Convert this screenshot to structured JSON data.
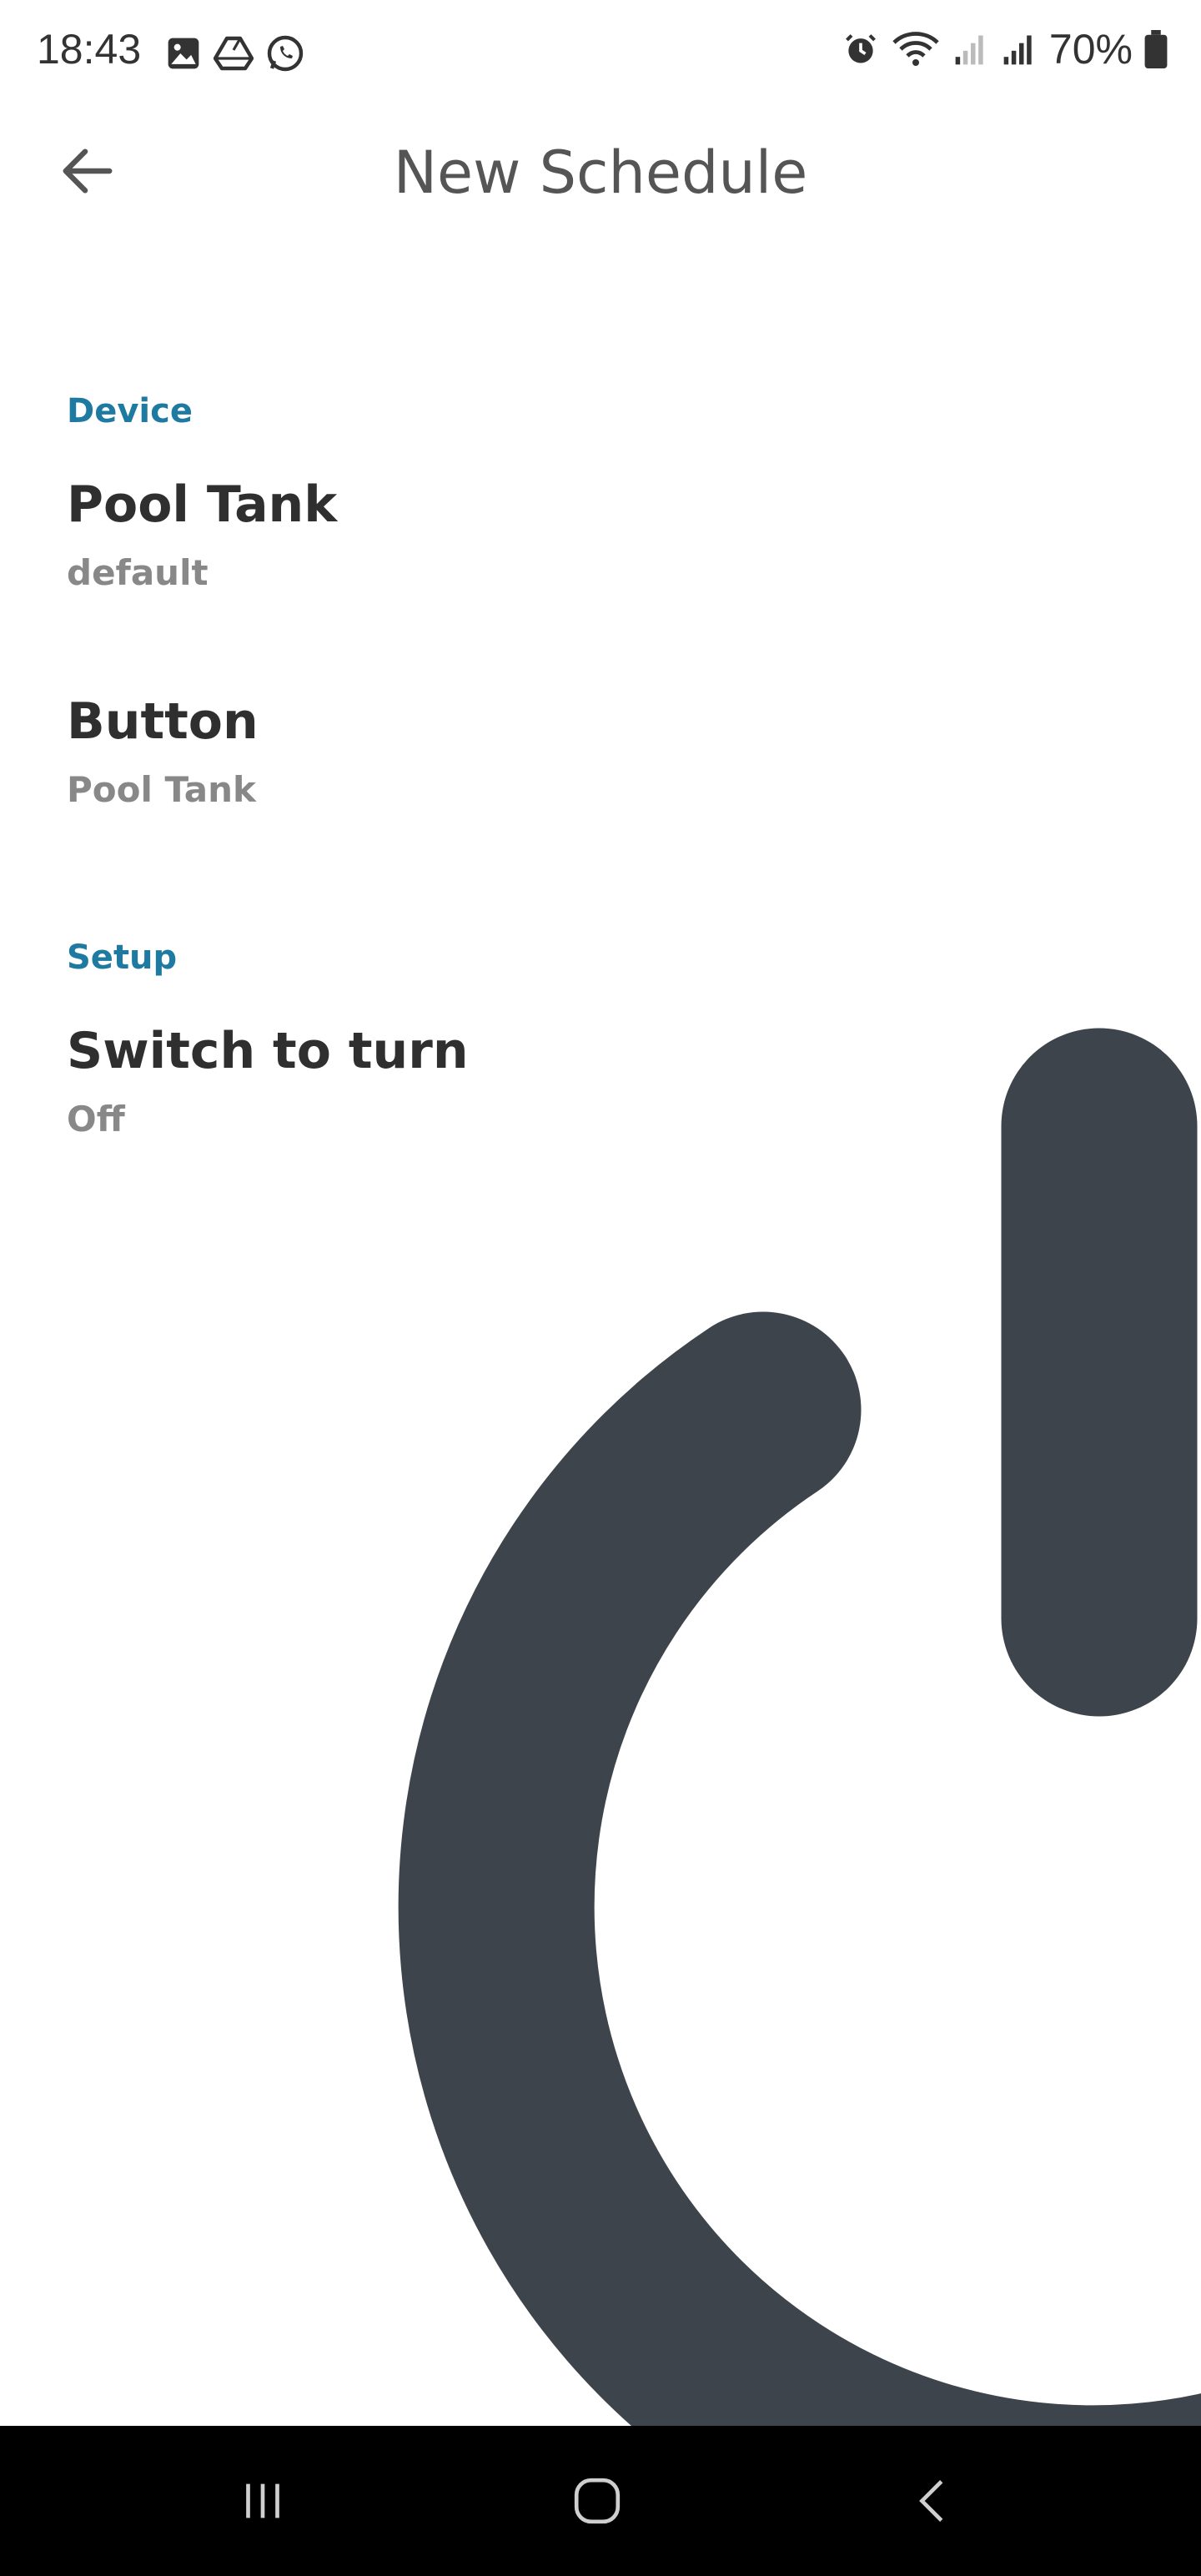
{
  "status_bar": {
    "time": "18:43",
    "battery_percent": "70%",
    "left_icons": [
      "image-icon",
      "drive-icon",
      "whatsapp-icon"
    ],
    "right_icons": [
      "alarm-icon",
      "wifi-icon",
      "signal-weak-icon",
      "signal-icon",
      "battery-icon"
    ]
  },
  "app_bar": {
    "title": "New Schedule",
    "back_icon": "arrow-left-icon"
  },
  "sections": {
    "device": {
      "header": "Device",
      "device_item": {
        "title": "Pool Tank",
        "subtitle": "default"
      },
      "button_item": {
        "title": "Button",
        "subtitle": "Pool Tank"
      }
    },
    "setup": {
      "header": "Setup",
      "switch_item": {
        "title": "Switch to turn",
        "subtitle": "Off"
      }
    }
  },
  "illustration": {
    "icon": "power-icon",
    "color": "#3d444b"
  },
  "nav_bar": {
    "buttons": [
      "recent-apps-icon",
      "home-icon",
      "back-icon"
    ]
  },
  "colors": {
    "accent": "#1e7aa0",
    "title_text": "#2f2f2f",
    "subtitle_text": "#888888",
    "nav_background": "#000000"
  }
}
